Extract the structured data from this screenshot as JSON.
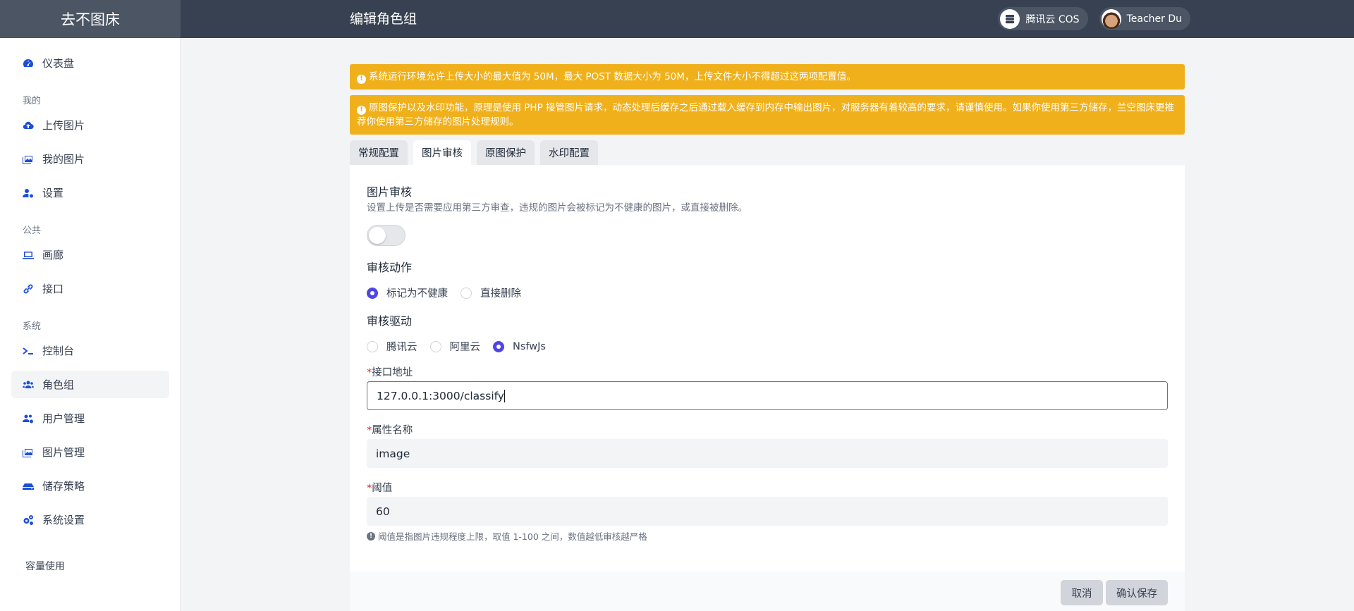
{
  "app": {
    "brand": "去不图床",
    "page_title": "编辑角色组"
  },
  "header": {
    "storage_label": "腾讯云 COS",
    "user_name": "Teacher Du"
  },
  "sidebar": {
    "dashboard": "仪表盘",
    "group_mine": "我的",
    "upload": "上传图片",
    "my_images": "我的图片",
    "settings": "设置",
    "group_public": "公共",
    "gallery": "画廊",
    "api": "接口",
    "group_system": "系统",
    "console": "控制台",
    "roles": "角色组",
    "users": "用户管理",
    "images": "图片管理",
    "storage": "储存策略",
    "system_settings": "系统设置",
    "capacity": "容量使用"
  },
  "alerts": {
    "upload_limit": "系统运行环境允许上传大小的最大值为 50M，最大 POST 数据大小为 50M，上传文件大小不得超过这两项配置值。",
    "protection": "原图保护以及水印功能，原理是使用 PHP 接管图片请求，动态处理后缓存之后通过载入缓存到内存中输出图片，对服务器有着较高的要求，请谨慎使用。如果你使用第三方储存，兰空图床更推荐你使用第三方储存的图片处理规则。"
  },
  "tabs": [
    "常规配置",
    "图片审核",
    "原图保护",
    "水印配置"
  ],
  "audit": {
    "title": "图片审核",
    "description": "设置上传是否需要应用第三方审查，违规的图片会被标记为不健康的图片，或直接被删除。",
    "enabled": false,
    "action_title": "审核动作",
    "action_options": [
      "标记为不健康",
      "直接删除"
    ],
    "action_selected": "标记为不健康",
    "driver_title": "审核驱动",
    "driver_options": [
      "腾讯云",
      "阿里云",
      "NsfwJs"
    ],
    "driver_selected": "NsfwJs",
    "endpoint_label": "接口地址",
    "endpoint_value": "127.0.0.1:3000/classify",
    "attr_label": "属性名称",
    "attr_value": "image",
    "threshold_label": "阈值",
    "threshold_value": "60",
    "threshold_hint": "阈值是指图片违规程度上限，取值 1-100 之间，数值越低审核越严格"
  },
  "actions": {
    "cancel": "取消",
    "save": "确认保存"
  }
}
